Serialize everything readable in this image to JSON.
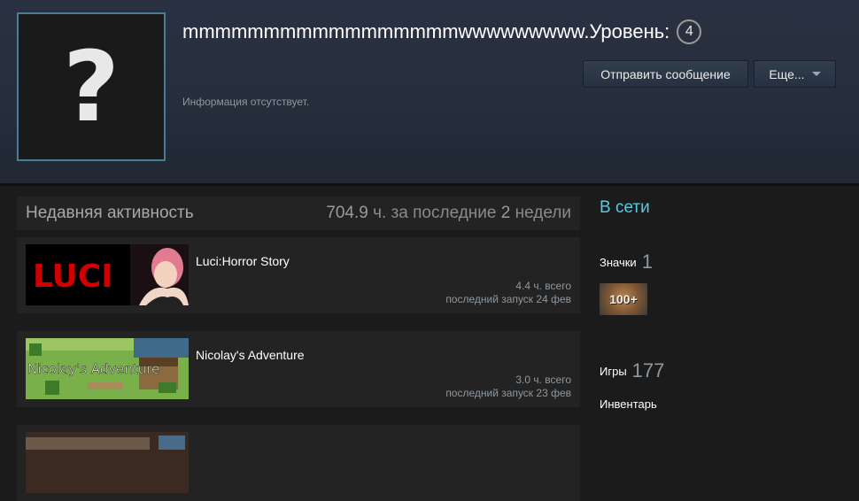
{
  "profile": {
    "persona_name": "mmmmmmmmmmmmmmmmmwwwwwwwww.",
    "level_label": "Уровень:",
    "level": "4",
    "summary": "Информация отсутствует.",
    "avatar_placeholder": "?"
  },
  "actions": {
    "send_message": "Отправить сообщение",
    "more": "Еще..."
  },
  "activity": {
    "title": "Недавняя активность",
    "hours_value": "704.9",
    "hours_text": "ч. за последние",
    "weeks_value": "2",
    "weeks_text": "недели"
  },
  "games": [
    {
      "name": "Luci:Horror Story",
      "capsule_text": "LUCI",
      "hours": "4.4 ч. всего",
      "last_played": "последний запуск 24 фев"
    },
    {
      "name": "Nicolay's Adventure",
      "capsule_text": "Nicolay's Adventure",
      "hours": "3.0 ч. всего",
      "last_played": "последний запуск 23 фев"
    },
    {
      "name": "",
      "capsule_text": "",
      "hours": "",
      "last_played": ""
    }
  ],
  "sidebar": {
    "status": "В сети",
    "badges_label": "Значки",
    "badges_count": "1",
    "badge_text": "100+",
    "games_label": "Игры",
    "games_count": "177",
    "inventory_label": "Инвентарь"
  },
  "colors": {
    "status_online": "#57cbde",
    "avatar_border": "#4b7c92",
    "page_bg": "#1b1b1b",
    "header_bg": "#2a3142"
  }
}
